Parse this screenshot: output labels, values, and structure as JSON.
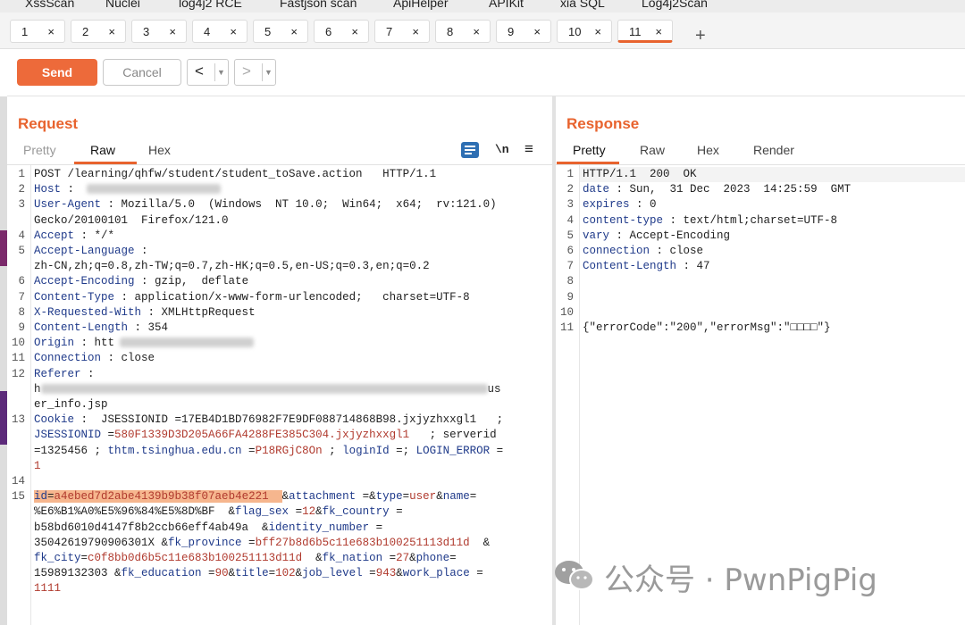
{
  "extension_tabs": [
    "XssScan",
    "Nuclei",
    "log4j2 RCE",
    "Fastjson scan",
    "ApiHelper",
    "APIKit",
    "xia SQL",
    "Log4j2Scan"
  ],
  "request_tabs": [
    "1",
    "2",
    "3",
    "4",
    "5",
    "6",
    "7",
    "8",
    "9",
    "10",
    "11"
  ],
  "close_glyph": "×",
  "add_tab_glyph": "+",
  "toolbar": {
    "send_label": "Send",
    "cancel_label": "Cancel",
    "back_glyph": "<",
    "forward_glyph": ">",
    "dropdown_glyph": "▼"
  },
  "request": {
    "title": "Request",
    "tabs": [
      "Pretty",
      "Raw",
      "Hex"
    ],
    "active_tab": "Raw",
    "icons": {
      "newline": "\\n",
      "menu": "≡"
    },
    "lines": [
      {
        "n": "1",
        "text": "POST /learning/qhfw/student/student_toSave.action   HTTP/1.1"
      },
      {
        "n": "2",
        "key": "Host",
        "sep": " : ",
        "val_blurred": true
      },
      {
        "n": "3",
        "key": "User-Agent",
        "sep": " : ",
        "val": "Mozilla/5.0  (Windows  NT 10.0;  Win64;  x64;  rv:121.0)"
      },
      {
        "n": "",
        "text": "Gecko/20100101  Firefox/121.0"
      },
      {
        "n": "4",
        "key": "Accept",
        "sep": " : ",
        "val": "*/*"
      },
      {
        "n": "5",
        "key": "Accept-Language",
        "sep": " :",
        "val": ""
      },
      {
        "n": "",
        "text": "zh-CN,zh;q=0.8,zh-TW;q=0.7,zh-HK;q=0.5,en-US;q=0.3,en;q=0.2"
      },
      {
        "n": "6",
        "key": "Accept-Encoding",
        "sep": " : ",
        "val": "gzip,  deflate"
      },
      {
        "n": "7",
        "key": "Content-Type",
        "sep": " : ",
        "val": "application/x-www-form-urlencoded;   charset=UTF-8"
      },
      {
        "n": "8",
        "key": "X-Requested-With",
        "sep": " : ",
        "val": "XMLHttpRequest"
      },
      {
        "n": "9",
        "key": "Content-Length",
        "sep": " : ",
        "val": "354"
      },
      {
        "n": "10",
        "key": "Origin",
        "sep": " : ",
        "val": "htt",
        "val_blurred": true
      },
      {
        "n": "11",
        "key": "Connection",
        "sep": " : ",
        "val": "close"
      },
      {
        "n": "12",
        "key": "Referer",
        "sep": " :",
        "val": ""
      },
      {
        "n": "",
        "text": "h",
        "blur_after": true,
        "tail": "us"
      },
      {
        "n": "",
        "text": "er_info.jsp"
      },
      {
        "n": "13",
        "key": "Cookie",
        "sep": " :  ",
        "val": "JSESSIONID =17EB4D1BD76982F7E9DF088714868B98.jxjyzhxxgl1   ;"
      },
      {
        "n": "",
        "text": "JSESSIONID =580F1339D3D205A66FA4288FE385C304.jxjyzhxxgl1   ; serverid",
        "colored": true
      },
      {
        "n": "",
        "text": "=1325456 ; thtm.tsinghua.edu.cn =P18RGjC8On ; loginId =; LOGIN_ERROR =",
        "colored": true
      },
      {
        "n": "",
        "text": "1",
        "colored": true
      },
      {
        "n": "14",
        "text": ""
      },
      {
        "n": "15",
        "text": "id=a4ebed7d2abe4139b9b38f07aeb4e221  &attachment =&type=user&name=",
        "highlight": "id=a4ebed7d2abe4139b9b38f07aeb4e221  ",
        "colored": true
      },
      {
        "n": "",
        "text": "%E6%B1%A0%E5%96%84%E5%8D%BF  &flag_sex =12&fk_country =",
        "colored": true
      },
      {
        "n": "",
        "text": "b58bd6010d4147f8b2ccb66eff4ab49a  &identity_number =",
        "colored": true
      },
      {
        "n": "",
        "text": "35042619790906301X &fk_province =bff27b8d6b5c11e683b100251113d11d  &",
        "colored": true
      },
      {
        "n": "",
        "text": "fk_city=c0f8bb0d6b5c11e683b100251113d11d  &fk_nation =27&phone=",
        "colored": true
      },
      {
        "n": "",
        "text": "15989132303 &fk_education =90&title=102&job_level =943&work_place =",
        "colored": true
      },
      {
        "n": "",
        "text": "1111",
        "colored": true
      }
    ]
  },
  "response": {
    "title": "Response",
    "tabs": [
      "Pretty",
      "Raw",
      "Hex",
      "Render"
    ],
    "active_tab": "Pretty",
    "lines": [
      {
        "n": "1",
        "text": "HTTP/1.1  200  OK"
      },
      {
        "n": "2",
        "key": "date",
        "sep": " : ",
        "val": "Sun,  31 Dec  2023  14:25:59  GMT"
      },
      {
        "n": "3",
        "key": "expires",
        "sep": " : ",
        "val": "0"
      },
      {
        "n": "4",
        "key": "content-type",
        "sep": " : ",
        "val": "text/html;charset=UTF-8"
      },
      {
        "n": "5",
        "key": "vary",
        "sep": " : ",
        "val": "Accept-Encoding"
      },
      {
        "n": "6",
        "key": "connection",
        "sep": " : ",
        "val": "close"
      },
      {
        "n": "7",
        "key": "Content-Length",
        "sep": " : ",
        "val": "47"
      },
      {
        "n": "8",
        "text": ""
      },
      {
        "n": "9",
        "text": ""
      },
      {
        "n": "10",
        "text": ""
      },
      {
        "n": "11",
        "text": "{\"errorCode\":\"200\",\"errorMsg\":\"□□□□\"}"
      }
    ]
  },
  "watermark": {
    "text": "公众号 · PwnPigPig"
  },
  "colors": {
    "accent": "#e8632e",
    "send": "#ed6a3a",
    "key": "#1f3a8a",
    "value": "#b03a2e",
    "highlight": "#f6b68e"
  }
}
